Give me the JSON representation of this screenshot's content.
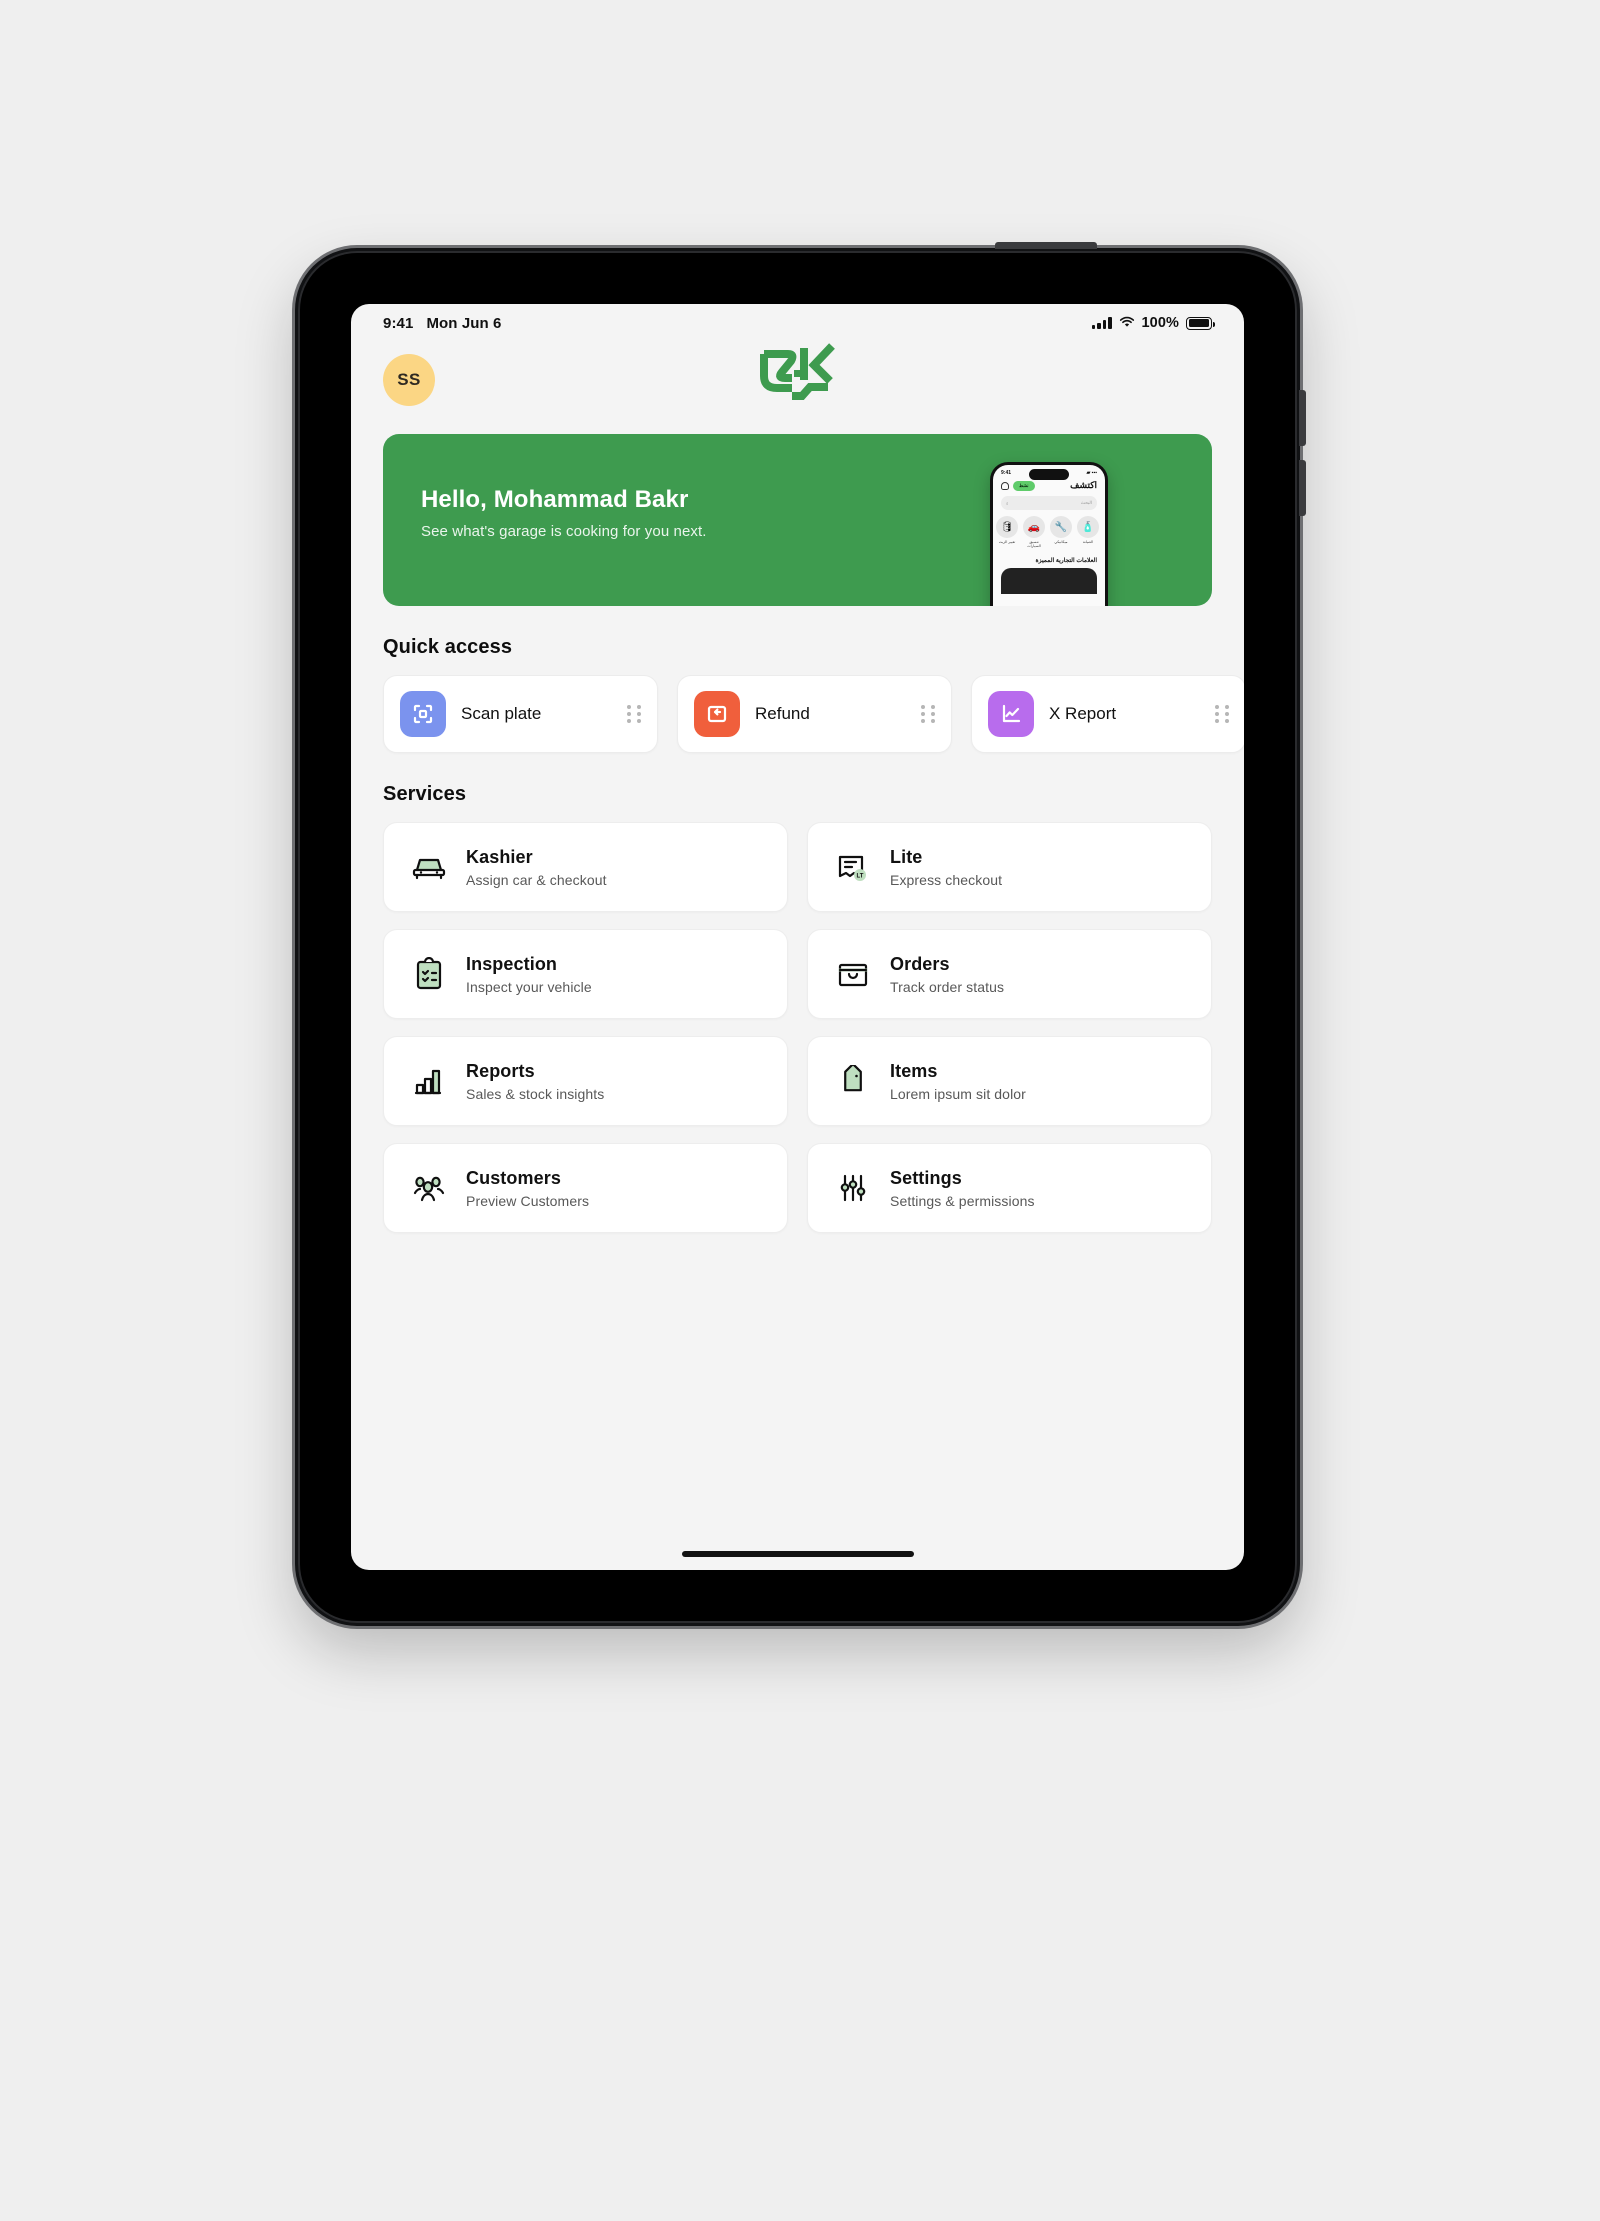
{
  "device": {
    "frame": "ipad-tablet-mockup",
    "background_color": "#efefef"
  },
  "status_bar": {
    "time": "9:41",
    "date": "Mon Jun 6",
    "battery_percent": "100%",
    "signal_icon": "cellular-signal-icon",
    "wifi_icon": "wifi-icon",
    "battery_icon": "battery-full-icon"
  },
  "header": {
    "avatar_initials": "SS",
    "avatar_color": "#fbd684",
    "logo_name": "kashier-arabic-logo",
    "logo_color": "#3e9b4f"
  },
  "hero": {
    "title": "Hello, Mohammad Bakr",
    "subtitle": "See what's garage is cooking for you next.",
    "background_color": "#3e9b4f",
    "phone_preview": {
      "status_time": "9:41",
      "screen_title": "اكتشف",
      "badge": "نشط",
      "search_placeholder": "البحث",
      "categories": [
        {
          "label": "الصيانة",
          "glyph": "🧴"
        },
        {
          "label": "ميكانيكي",
          "glyph": "🔧"
        },
        {
          "label": "تنسيق السيارات",
          "glyph": "🚗"
        },
        {
          "label": "تغيير الزيت",
          "glyph": "🛢"
        }
      ],
      "section_label": "العلامات التجارية المميزة"
    }
  },
  "quick_access": {
    "title": "Quick access",
    "items": [
      {
        "label": "Scan plate",
        "icon": "scan-frame-icon",
        "color": "#7b93ee"
      },
      {
        "label": "Refund",
        "icon": "return-arrow-icon",
        "color": "#f05f3c"
      },
      {
        "label": "X Report",
        "icon": "line-chart-icon",
        "color": "#b86ced"
      }
    ],
    "drag_handle_icon": "six-dot-drag-handle-icon"
  },
  "services": {
    "title": "Services",
    "items": [
      {
        "name": "Kashier",
        "desc": "Assign car & checkout",
        "icon": "car-icon"
      },
      {
        "name": "Lite",
        "desc": "Express checkout",
        "icon": "receipt-lt-icon"
      },
      {
        "name": "Inspection",
        "desc": "Inspect your vehicle",
        "icon": "clipboard-checklist-icon"
      },
      {
        "name": "Orders",
        "desc": "Track order status",
        "icon": "shopping-bag-icon"
      },
      {
        "name": "Reports",
        "desc": "Sales & stock insights",
        "icon": "bar-chart-icon"
      },
      {
        "name": "Items",
        "desc": "Lorem ipsum sit dolor",
        "icon": "price-tag-icon"
      },
      {
        "name": "Customers",
        "desc": "Preview Customers",
        "icon": "people-group-icon"
      },
      {
        "name": "Settings",
        "desc": "Settings & permissions",
        "icon": "sliders-icon"
      }
    ]
  },
  "accent_green": "#3e9b4f",
  "icon_fill_green": "#bfdfc0"
}
